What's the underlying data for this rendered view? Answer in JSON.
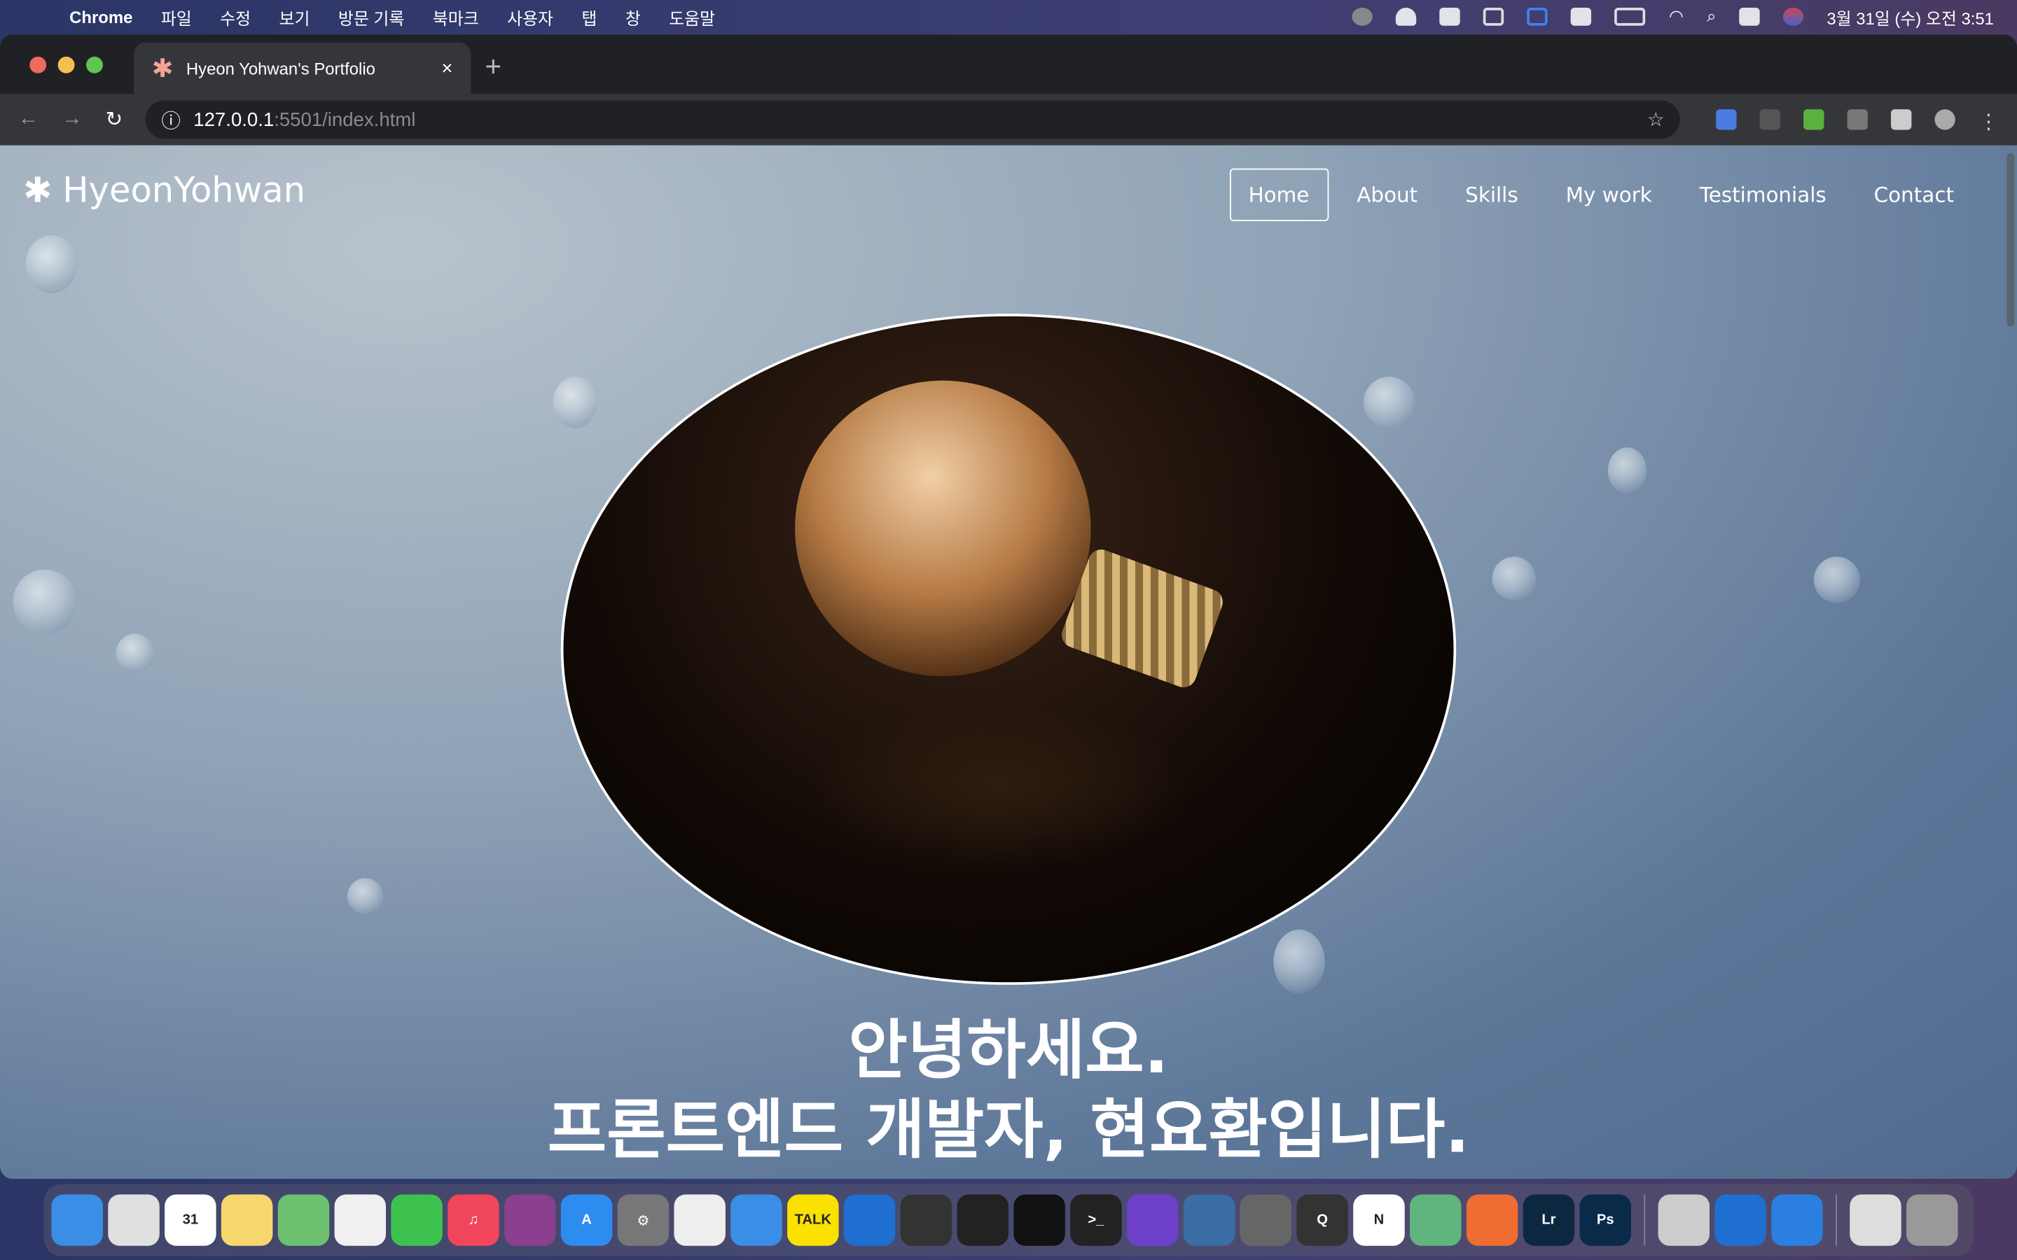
{
  "menubar": {
    "app": "Chrome",
    "items": [
      "파일",
      "수정",
      "보기",
      "방문 기록",
      "북마크",
      "사용자",
      "탭",
      "창",
      "도움말"
    ],
    "clock": "3월 31일 (수) 오전 3:51"
  },
  "browser": {
    "tab_title": "Hyeon Yohwan's Portfolio",
    "url_host": "127.0.0.1",
    "url_rest": ":5501/index.html",
    "new_tab": "+",
    "close": "×"
  },
  "site": {
    "logo": "HyeonYohwan",
    "nav": [
      "Home",
      "About",
      "Skills",
      "My work",
      "Testimonials",
      "Contact"
    ],
    "active_nav": "Home",
    "headline_1": "안녕하세요.",
    "headline_2": "프론트엔드 개발자, 현요환입니다."
  },
  "dock": [
    {
      "name": "finder",
      "color": "#3a8ee6",
      "label": ""
    },
    {
      "name": "chrome",
      "color": "#e0e0e0",
      "label": ""
    },
    {
      "name": "calendar",
      "color": "#ffffff",
      "label": "31"
    },
    {
      "name": "notes",
      "color": "#f5d76e",
      "label": ""
    },
    {
      "name": "maps",
      "color": "#6cc070",
      "label": ""
    },
    {
      "name": "photos",
      "color": "#f0f0f0",
      "label": ""
    },
    {
      "name": "facetime",
      "color": "#3ec24f",
      "label": ""
    },
    {
      "name": "music",
      "color": "#f0455b",
      "label": "♫"
    },
    {
      "name": "screen-recorder",
      "color": "#8a3f8f",
      "label": ""
    },
    {
      "name": "app-store",
      "color": "#2d8cf0",
      "label": "A"
    },
    {
      "name": "system-preferences",
      "color": "#777",
      "label": "⚙"
    },
    {
      "name": "textedit",
      "color": "#eee",
      "label": ""
    },
    {
      "name": "archive",
      "color": "#3a8ee6",
      "label": ""
    },
    {
      "name": "kakaotalk",
      "color": "#fae100",
      "label": "TALK"
    },
    {
      "name": "vscode",
      "color": "#1f6fd0",
      "label": ""
    },
    {
      "name": "final-cut",
      "color": "#333",
      "label": ""
    },
    {
      "name": "davinci-resolve",
      "color": "#222",
      "label": ""
    },
    {
      "name": "iterm",
      "color": "#111",
      "label": ""
    },
    {
      "name": "terminal",
      "color": "#222",
      "label": ">_"
    },
    {
      "name": "github-desktop",
      "color": "#6e40c9",
      "label": ""
    },
    {
      "name": "network-radar",
      "color": "#3a6ea5",
      "label": ""
    },
    {
      "name": "xcode-sim",
      "color": "#666",
      "label": ""
    },
    {
      "name": "quicktime",
      "color": "#333",
      "label": "Q"
    },
    {
      "name": "notion",
      "color": "#fff",
      "label": "N"
    },
    {
      "name": "atom",
      "color": "#5fb57d",
      "label": ""
    },
    {
      "name": "postman",
      "color": "#ef6c33",
      "label": ""
    },
    {
      "name": "lightroom",
      "color": "#0b2840",
      "label": "Lr"
    },
    {
      "name": "photoshop",
      "color": "#0a2a4a",
      "label": "Ps"
    },
    {
      "name": "preview",
      "color": "#ccc",
      "label": ""
    },
    {
      "name": "vscode-2",
      "color": "#1f6fd0",
      "label": ""
    },
    {
      "name": "vscode-3",
      "color": "#2a7fe0",
      "label": ""
    },
    {
      "name": "downloads",
      "color": "#ddd",
      "label": ""
    },
    {
      "name": "trash",
      "color": "#999",
      "label": ""
    }
  ]
}
